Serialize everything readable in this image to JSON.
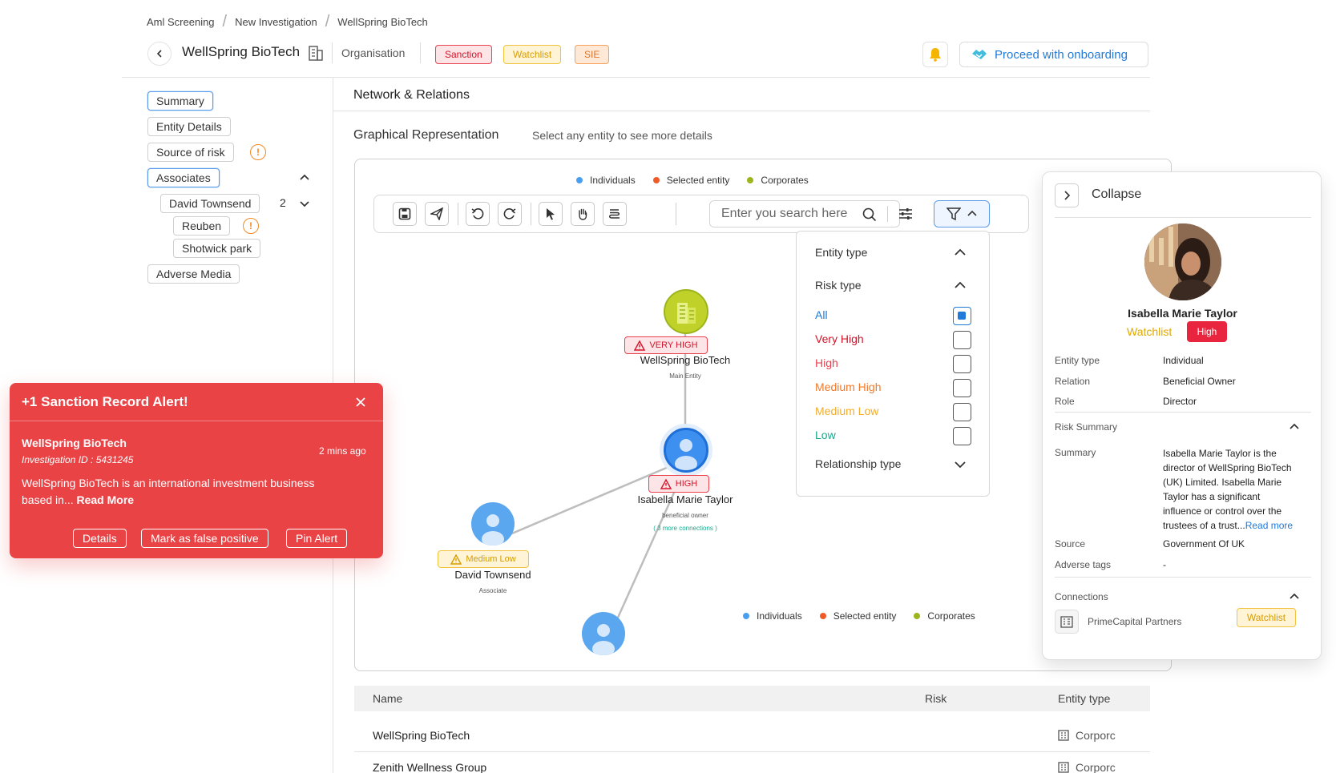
{
  "breadcrumb": [
    "Aml Screening",
    "New Investigation",
    "WellSpring BioTech"
  ],
  "header": {
    "title": "WellSpring BioTech",
    "entity_kind": "Organisation",
    "tags": [
      "Sanction",
      "Watchlist",
      "SIE"
    ],
    "proceed_label": "Proceed with onboarding"
  },
  "sidebar": {
    "summary": "Summary",
    "entity_details": "Entity Details",
    "source_of_risk": "Source of risk",
    "associates": "Associates",
    "david": "David Townsend",
    "david_count": "2",
    "reuben": "Reuben",
    "shotwick": "Shotwick park",
    "adverse_media": "Adverse Media"
  },
  "section": {
    "title": "Network & Relations",
    "graph_title": "Graphical Representation",
    "graph_hint": "Select any entity to see more details"
  },
  "legend": [
    "Individuals",
    "Selected entity",
    "Corporates"
  ],
  "toolbar": {
    "search_placeholder": "Enter you search here"
  },
  "filter": {
    "entity_type": "Entity type",
    "risk_type": "Risk type",
    "options": [
      "All",
      "Very High",
      "High",
      "Medium High",
      "Medium Low",
      "Low"
    ],
    "relationship_type": "Relationship type"
  },
  "graph": {
    "main": {
      "name": "WellSpring BioTech",
      "role": "Main Entity",
      "risk": "VERY HIGH"
    },
    "selected": {
      "name": "Isabella Marie Taylor",
      "role": "beneficial owner",
      "risk": "HIGH",
      "more": "( 3 more connections )"
    },
    "associate": {
      "name": "David Townsend",
      "role": "Associate",
      "risk": "Medium Low"
    }
  },
  "table": {
    "headers": [
      "Name",
      "Risk",
      "Entity type"
    ],
    "rows": [
      {
        "name": "WellSpring BioTech",
        "type": "Corporc"
      },
      {
        "name": "Zenith Wellness Group",
        "type": "Corporc"
      }
    ]
  },
  "alert": {
    "title": "+1 Sanction Record Alert!",
    "entity": "WellSpring BioTech",
    "investigation": "Investigation ID : 5431245",
    "time": "2 mins ago",
    "body": "WellSpring BioTech is an international investment business based in...",
    "read_more": "Read More",
    "buttons": [
      "Details",
      "Mark as false positive",
      "Pin Alert"
    ]
  },
  "panel": {
    "collapse": "Collapse",
    "name": "Isabella Marie Taylor",
    "tag1": "Watchlist",
    "tag2": "High",
    "entity_type_k": "Entity type",
    "entity_type_v": "Individual",
    "relation_k": "Relation",
    "relation_v": "Beneficial Owner",
    "role_k": "Role",
    "role_v": "Director",
    "risk_summary": "Risk Summary",
    "summary_k": "Summary",
    "summary_lines": [
      "Isabella Marie Taylor is the",
      "director of WellSpring BioTech",
      "(UK) Limited. Isabella Marie",
      "Taylor has a significant",
      "influence or control over the",
      "trustees of a trust..."
    ],
    "read_more": "Read more",
    "source_k": "Source",
    "source_v": "Government Of UK",
    "adverse_k": "Adverse tags",
    "adverse_v": "-",
    "connections": "Connections",
    "conn_name": "PrimeCapital Partners",
    "conn_tag": "Watchlist"
  },
  "colors": {
    "accent": "#1f7ad8",
    "alert": "#ea4346",
    "individual": "#4a9ef0",
    "selected": "#f05a28",
    "corporate": "#9cb51d"
  }
}
